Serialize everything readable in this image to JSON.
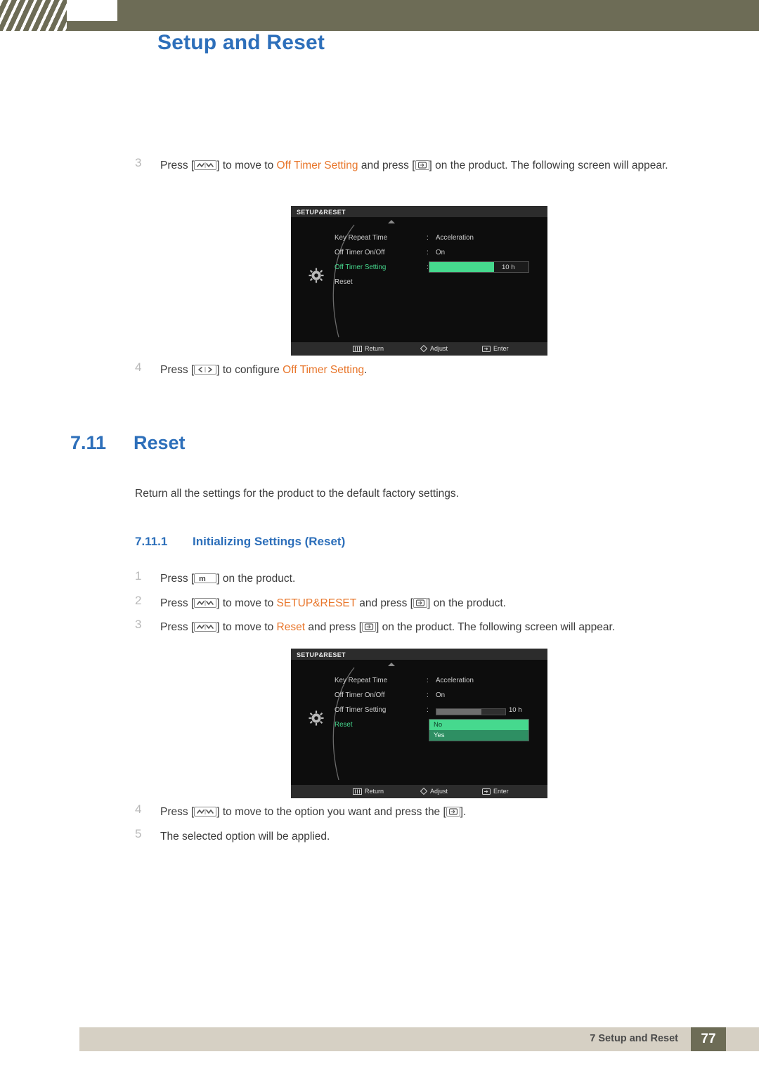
{
  "header": {
    "title": "Setup and Reset"
  },
  "section_off_timer": {
    "step3_num": "3",
    "step3_pre": "Press [",
    "step3_mid": "] to move to ",
    "step3_target": "Off Timer Setting",
    "step3_and": " and press [",
    "step3_post": "] on the product. The following screen will appear.",
    "step4_num": "4",
    "step4_pre": "Press [",
    "step4_mid": "] to configure ",
    "step4_target": "Off Timer Setting",
    "step4_post": "."
  },
  "osd1": {
    "title": "SETUP&RESET",
    "rows": [
      {
        "label": "Key Repeat Time",
        "colon": ":",
        "value": "Acceleration",
        "selected": false
      },
      {
        "label": "Off Timer On/Off",
        "colon": ":",
        "value": "On",
        "selected": false
      },
      {
        "label": "Off Timer Setting",
        "colon": ":",
        "value": "",
        "selected": true
      },
      {
        "label": "Reset",
        "colon": "",
        "value": "",
        "selected": false
      }
    ],
    "slider_value": "10 h",
    "slider_percent": 65,
    "bottom": {
      "return": "Return",
      "adjust": "Adjust",
      "enter": "Enter"
    }
  },
  "section_reset": {
    "heading_num": "7.11",
    "heading_text": "Reset",
    "intro": "Return all the settings for the product to the default factory settings.",
    "sub_num": "7.11.1",
    "sub_text": "Initializing Settings (Reset)",
    "step1_num": "1",
    "step1_pre": "Press [",
    "step1_post": "] on the product.",
    "step1_key": "m",
    "step2_num": "2",
    "step2_pre": "Press [",
    "step2_mid": "] to move to ",
    "step2_target": "SETUP&RESET",
    "step2_and": " and press [",
    "step2_post": "] on the product.",
    "step3_num": "3",
    "step3_pre": "Press [",
    "step3_mid": "] to move to ",
    "step3_target": "Reset",
    "step3_and": " and press [",
    "step3_post": "] on the product. The following screen will appear.",
    "step4_num": "4",
    "step4_pre": "Press [",
    "step4_mid": "] to move to the option you want and press the [",
    "step4_post": "].",
    "step5_num": "5",
    "step5_text": "The selected option will be applied."
  },
  "osd2": {
    "title": "SETUP&RESET",
    "rows": [
      {
        "label": "Key Repeat Time",
        "colon": ":",
        "value": "Acceleration",
        "selected": false
      },
      {
        "label": "Off Timer On/Off",
        "colon": ":",
        "value": "On",
        "selected": false
      },
      {
        "label": "Off Timer Setting",
        "colon": ":",
        "value": "",
        "selected": false
      },
      {
        "label": "Reset",
        "colon": "",
        "value": "",
        "selected": true
      }
    ],
    "slider_value": "10 h",
    "slider_percent": 65,
    "options": [
      {
        "label": "No",
        "state": "highlight"
      },
      {
        "label": "Yes",
        "state": "selected"
      }
    ],
    "bottom": {
      "return": "Return",
      "adjust": "Adjust",
      "enter": "Enter"
    }
  },
  "footer": {
    "text": "7 Setup and Reset",
    "page": "77"
  },
  "colors": {
    "accent_blue": "#2d6fba",
    "orange": "#e8762b",
    "osd_green": "#46d98e",
    "header_olive": "#6d6c56",
    "footer_band": "#d6d0c4"
  }
}
